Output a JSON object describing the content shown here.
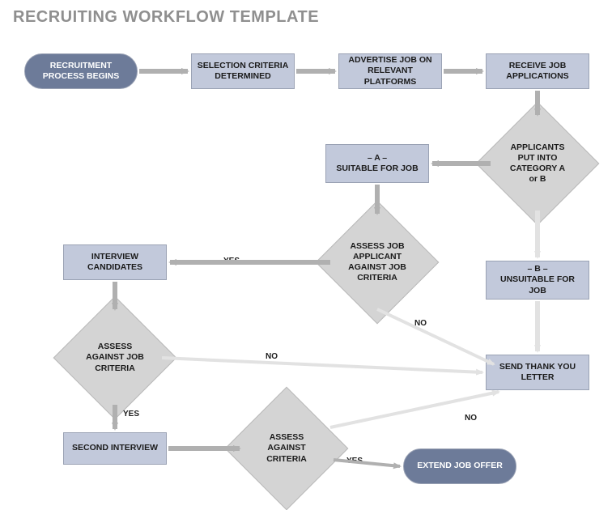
{
  "title": "RECRUITING WORKFLOW TEMPLATE",
  "nodes": {
    "start": "RECRUITMENT PROCESS BEGINS",
    "criteria": "SELECTION CRITERIA DETERMINED",
    "advertise": "ADVERTISE JOB ON RELEVANT PLATFORMS",
    "receive": "RECEIVE JOB APPLICATIONS",
    "categorize": "APPLICANTS PUT INTO CATEGORY A or B",
    "catA": "– A –\nSUITABLE FOR JOB",
    "catB": "– B –\nUNSUITABLE FOR JOB",
    "assess1": "ASSESS JOB APPLICANT AGAINST JOB CRITERIA",
    "interview": "INTERVIEW CANDIDATES",
    "assess2": "ASSESS AGAINST JOB CRITERIA",
    "second": "SECOND INTERVIEW",
    "assess3": "ASSESS AGAINST CRITERIA",
    "thankyou": "SEND THANK YOU LETTER",
    "offer": "EXTEND JOB OFFER"
  },
  "labels": {
    "yes": "YES",
    "no": "NO"
  }
}
